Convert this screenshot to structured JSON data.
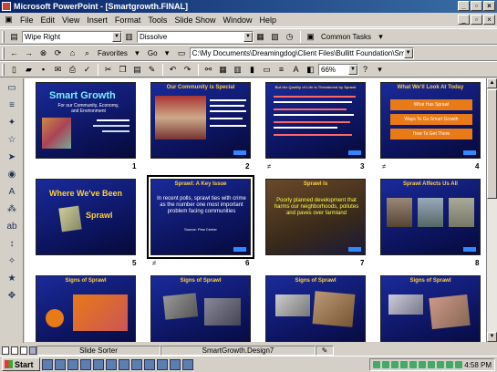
{
  "window": {
    "title": "Microsoft PowerPoint - [Smartgrowth.FINAL]"
  },
  "menu": [
    "File",
    "Edit",
    "View",
    "Insert",
    "Format",
    "Tools",
    "Slide Show",
    "Window",
    "Help"
  ],
  "toolbar1": {
    "transition_effect": "Wipe Right",
    "transition_effect2": "Dissolve",
    "common_tasks": "Common Tasks"
  },
  "toolbar2": {
    "favorites": "Favorites",
    "go": "Go",
    "address": "C:\\My Documents\\Dreamingdog\\Client Files\\Bullitt Foundation\\Sma"
  },
  "toolbar3": {
    "zoom": "66%"
  },
  "slides": [
    {
      "num": "1",
      "title": "Smart Growth",
      "subtitle": "For our Community, Economy, and Environment",
      "transition": ""
    },
    {
      "num": "2",
      "title": "Our Community is Special",
      "transition": ""
    },
    {
      "num": "3",
      "title": "But the Quality of Life is Threatened by Sprawl",
      "transition": "≠"
    },
    {
      "num": "4",
      "title": "What We'll Look At Today",
      "buttons": [
        "What Has Sprawl",
        "Ways To Go Smart Growth",
        "How To Get There"
      ],
      "transition": "≠"
    },
    {
      "num": "5",
      "title": "Where We've Been",
      "subtitle": "Sprawl",
      "transition": ""
    },
    {
      "num": "6",
      "title": "Sprawl: A Key Issue",
      "body": "In recent polls, sprawl ties with crime as the number one most important problem facing communities",
      "source": "Source: Pew Center",
      "transition": "≠"
    },
    {
      "num": "7",
      "title": "Sprawl Is",
      "body": "Poorly planned development that harms our neighborhoods, pollutes and paves over farmland",
      "transition": ""
    },
    {
      "num": "8",
      "title": "Sprawl Affects Us All",
      "transition": ""
    },
    {
      "num": "9",
      "title": "Signs of Sprawl",
      "transition": ""
    },
    {
      "num": "10",
      "title": "Signs of Sprawl",
      "transition": ""
    },
    {
      "num": "11",
      "title": "Signs of Sprawl",
      "transition": ""
    },
    {
      "num": "12",
      "title": "Signs of Sprawl",
      "transition": ""
    }
  ],
  "status": {
    "view": "Slide Sorter",
    "design": "SmartGrowth.Design7"
  },
  "taskbar": {
    "start": "Start",
    "time": "4:58 PM"
  },
  "colors": {
    "slide_bg": "#0b1258",
    "slide_title": "#ffd040",
    "titlebar": "#0a246a"
  }
}
